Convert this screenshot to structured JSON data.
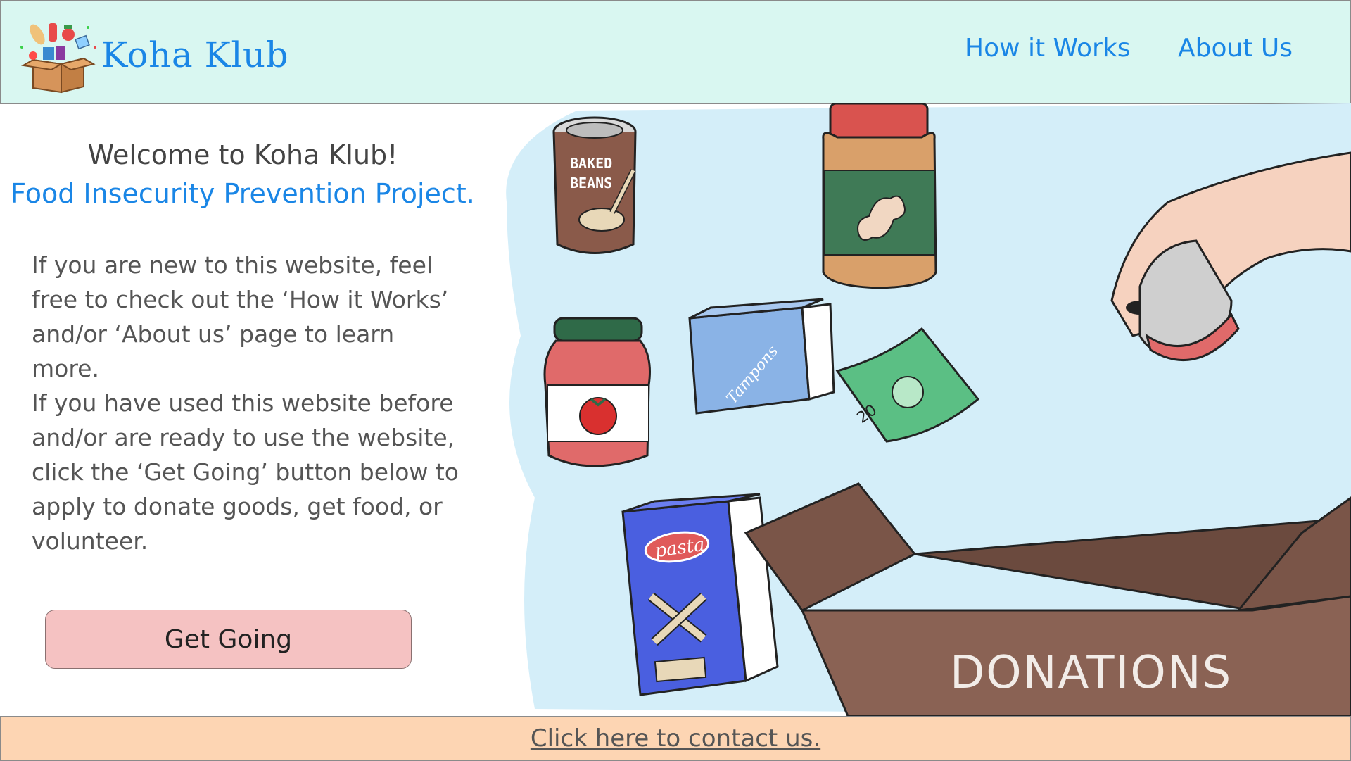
{
  "header": {
    "brand": "Koha Klub",
    "nav": [
      {
        "label": "How it Works"
      },
      {
        "label": "About Us"
      }
    ]
  },
  "intro": {
    "welcome": "Welcome to Koha Klub!",
    "subtitle": "Food Insecurity Prevention Project.",
    "paragraph1": "If you are new to this website, feel free to check out the ‘How it Works’ and/or ‘About us’ page to learn more.",
    "paragraph2": "If you have used this website before and/or are ready to use the website, click the ‘Get Going’ button below to apply to  donate goods, get food, or volunteer.",
    "cta_label": "Get Going"
  },
  "illustration": {
    "can_label_line1": "BAKED",
    "can_label_line2": "BEANS",
    "tampons_label": "Tampons",
    "pasta_label": "pasta",
    "banknote_value": "20",
    "box_label": "DONATIONS"
  },
  "footer": {
    "contact_link": "Click here to contact us."
  },
  "colors": {
    "header_bg": "#d9f7f1",
    "accent_blue": "#1a86e6",
    "button_bg": "#f5c2c2",
    "footer_bg": "#fdd5b3"
  }
}
